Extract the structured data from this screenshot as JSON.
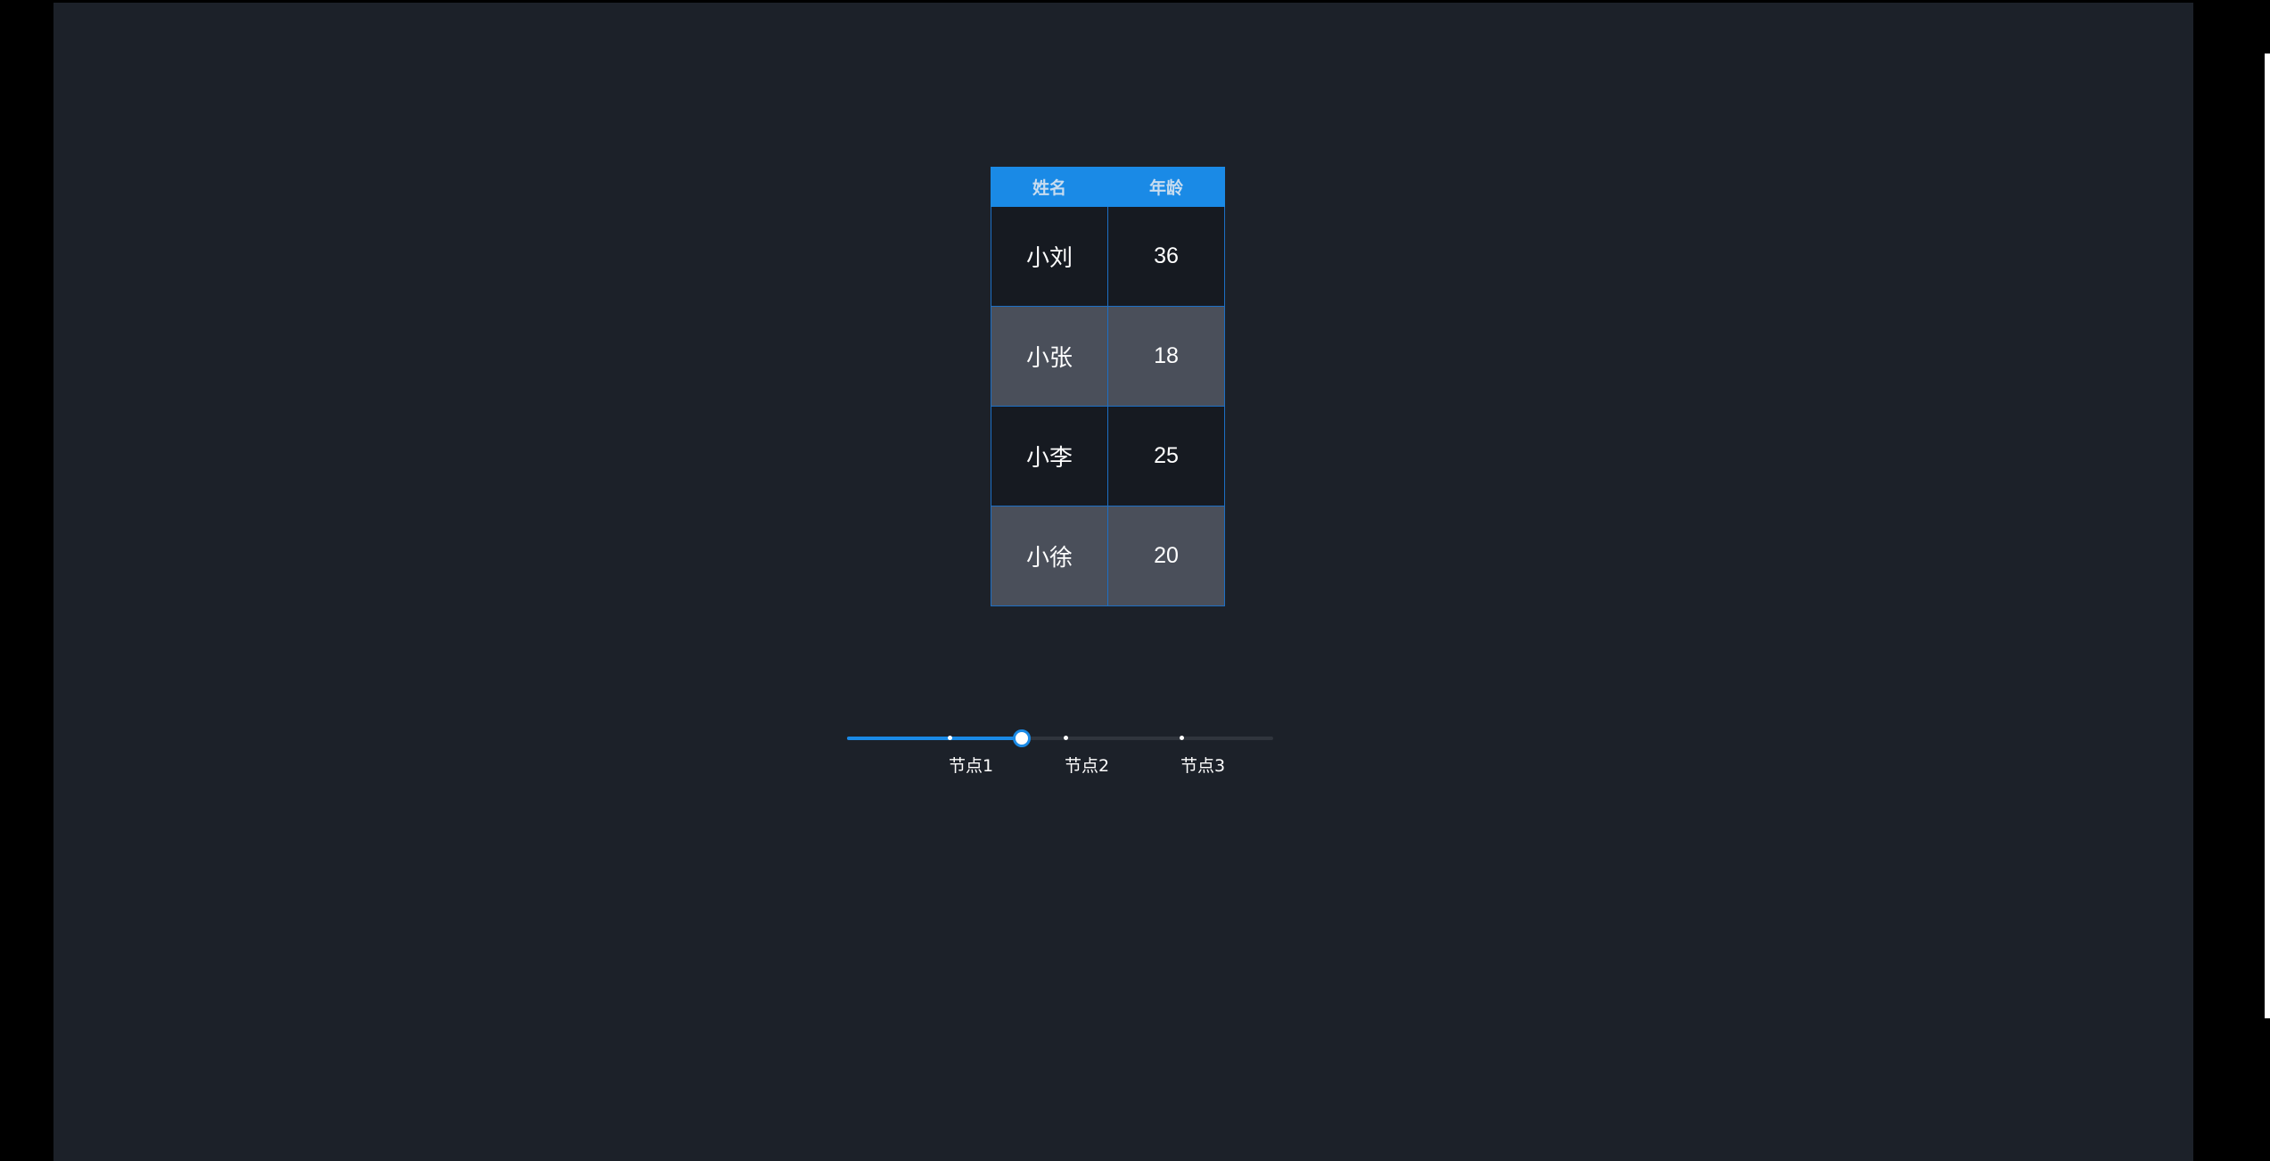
{
  "table": {
    "headers": [
      "姓名",
      "年龄"
    ],
    "rows": [
      {
        "name": "小刘",
        "age": "36"
      },
      {
        "name": "小张",
        "age": "18"
      },
      {
        "name": "小李",
        "age": "25"
      },
      {
        "name": "小徐",
        "age": "20"
      }
    ]
  },
  "slider": {
    "value_fraction": 0.41,
    "marks": [
      "节点1",
      "节点2",
      "节点3"
    ],
    "colors": {
      "accent": "#1a8ae6",
      "rail": "#30353d"
    }
  },
  "colors": {
    "background": "#1c2129",
    "header": "#1a8ae6",
    "row_dark": "#161a21",
    "row_light": "#4a4f5a"
  }
}
